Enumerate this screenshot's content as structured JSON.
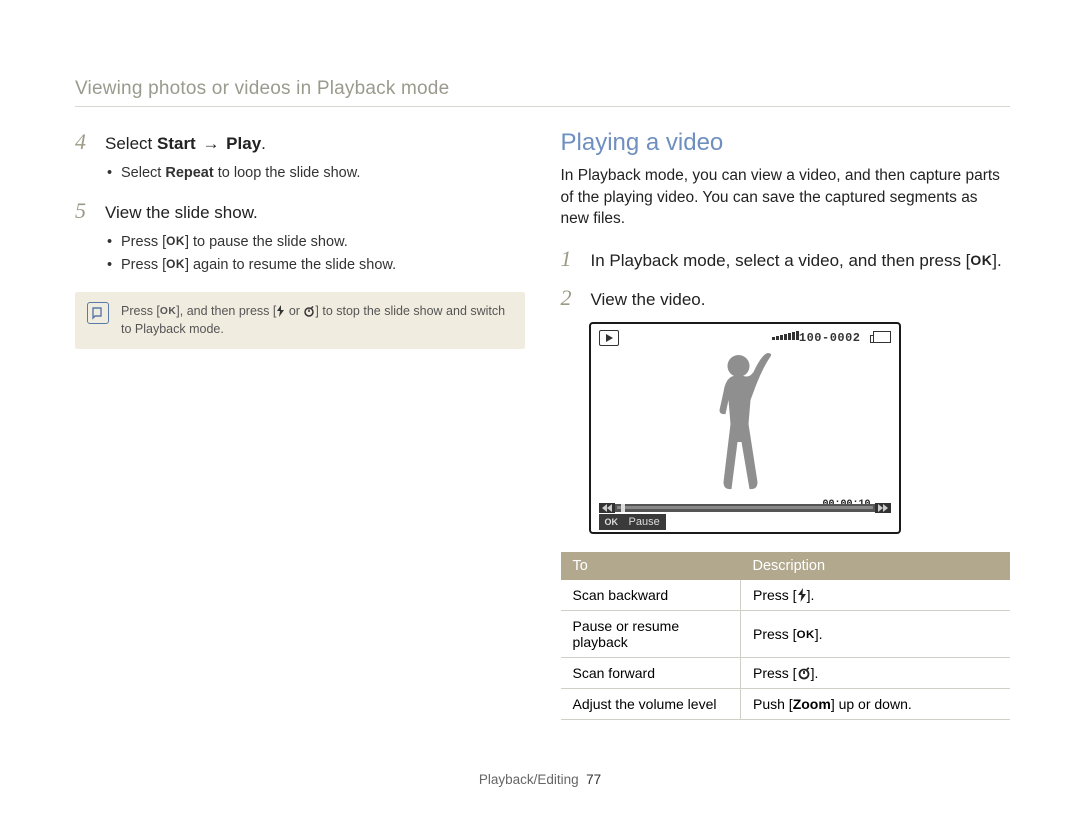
{
  "header": {
    "title": "Viewing photos or videos in Playback mode"
  },
  "left": {
    "step4": {
      "num": "4",
      "prefix": "Select ",
      "bold1": "Start",
      "arrow": " → ",
      "bold2": "Play",
      "suffix": "."
    },
    "step4_bullets": [
      {
        "pre": "Select ",
        "bold": "Repeat",
        "post": " to loop the slide show."
      }
    ],
    "step5": {
      "num": "5",
      "text": "View the slide show."
    },
    "step5_bullets": [
      {
        "pre": "Press [",
        "ok": "OK",
        "post": "] to pause the slide show."
      },
      {
        "pre": "Press [",
        "ok": "OK",
        "post": "] again to resume the slide show."
      }
    ],
    "note": {
      "pre": "Press [",
      "ok1": "OK",
      "mid1": "], and then press [",
      "mid2": " or ",
      "mid3": "] to stop the slide show and switch to Playback mode."
    }
  },
  "right": {
    "heading": "Playing a video",
    "intro": "In Playback mode, you can view a video, and then capture parts of the playing video. You can save the captured segments as new files.",
    "step1": {
      "num": "1",
      "pre": "In Playback mode, select a video, and then press [",
      "ok": "OK",
      "post": "]."
    },
    "step2": {
      "num": "2",
      "text": "View the video."
    },
    "screen": {
      "counter": "100-0002",
      "time": "00:00:10",
      "pause_label": "Pause",
      "ok": "OK"
    },
    "table": {
      "head": {
        "to": "To",
        "desc": "Description"
      },
      "rows": [
        {
          "to": "Scan backward",
          "desc_pre": "Press [",
          "icon": "flash",
          "desc_post": "]."
        },
        {
          "to": "Pause or resume playback",
          "desc_pre": "Press [",
          "icon": "ok",
          "desc_post": "]."
        },
        {
          "to": "Scan forward",
          "desc_pre": "Press [",
          "icon": "timer",
          "desc_post": "]."
        },
        {
          "to": "Adjust the volume level",
          "desc_pre": "Push [",
          "bold": "Zoom",
          "desc_post": "] up or down."
        }
      ]
    }
  },
  "footer": {
    "section": "Playback/Editing",
    "page": "77"
  }
}
